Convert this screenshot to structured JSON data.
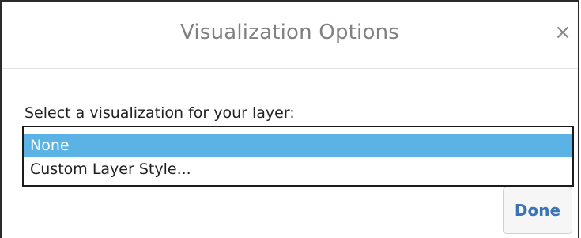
{
  "dialog": {
    "title": "Visualization Options",
    "close_glyph": "×",
    "close_icon": "close-icon"
  },
  "content": {
    "prompt": "Select a visualization for your layer:",
    "options": [
      {
        "label": "None",
        "selected": true
      },
      {
        "label": "Custom Layer Style...",
        "selected": false
      }
    ]
  },
  "footer": {
    "done_label": "Done"
  },
  "colors": {
    "selection": "#5ab3e4",
    "done_text": "#3a74b5",
    "title_text": "#808080"
  }
}
